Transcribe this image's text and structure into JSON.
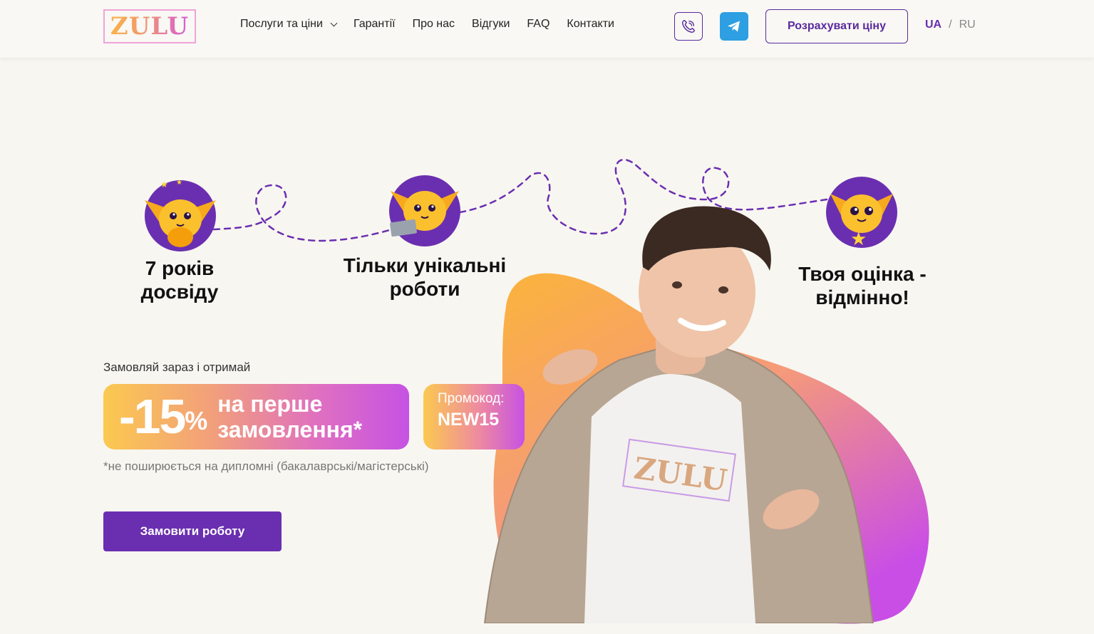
{
  "header": {
    "logo_text": "ZULU",
    "nav": [
      {
        "label": "Послуги та ціни",
        "has_dropdown": true
      },
      {
        "label": "Гарантії"
      },
      {
        "label": "Про нас"
      },
      {
        "label": "Відгуки"
      },
      {
        "label": "FAQ"
      },
      {
        "label": "Контакти"
      }
    ],
    "icons": {
      "viber": "viber-phone-icon",
      "telegram": "telegram-icon"
    },
    "calc_button": "Розрахувати ціну",
    "lang": {
      "ua": "UA",
      "separator": "/",
      "ru": "RU",
      "active": "UA"
    }
  },
  "features": [
    {
      "line1": "7 років",
      "line2": "досвіду"
    },
    {
      "line1": "Тільки унікальні",
      "line2": "роботи"
    },
    {
      "line1": "Твоя оцінка -",
      "line2": "відмінно!"
    }
  ],
  "promo": {
    "lead": "Замовляй зараз і отримай",
    "discount": "-15",
    "percent": "%",
    "text_line1": "на перше",
    "text_line2": "замовлення*",
    "code_label": "Промокод:",
    "code_value": "NEW15",
    "note": "*не поширюється на дипломні (бакалаврські/магістерські)"
  },
  "shirt_logo": "ZULU",
  "order_button": "Замовити роботу",
  "colors": {
    "accent_purple": "#6a2fb0",
    "telegram_blue": "#2d9fe2",
    "gradient_yellow": "#fbc950",
    "gradient_pink": "#c652e4",
    "background": "#f8f6f1"
  }
}
